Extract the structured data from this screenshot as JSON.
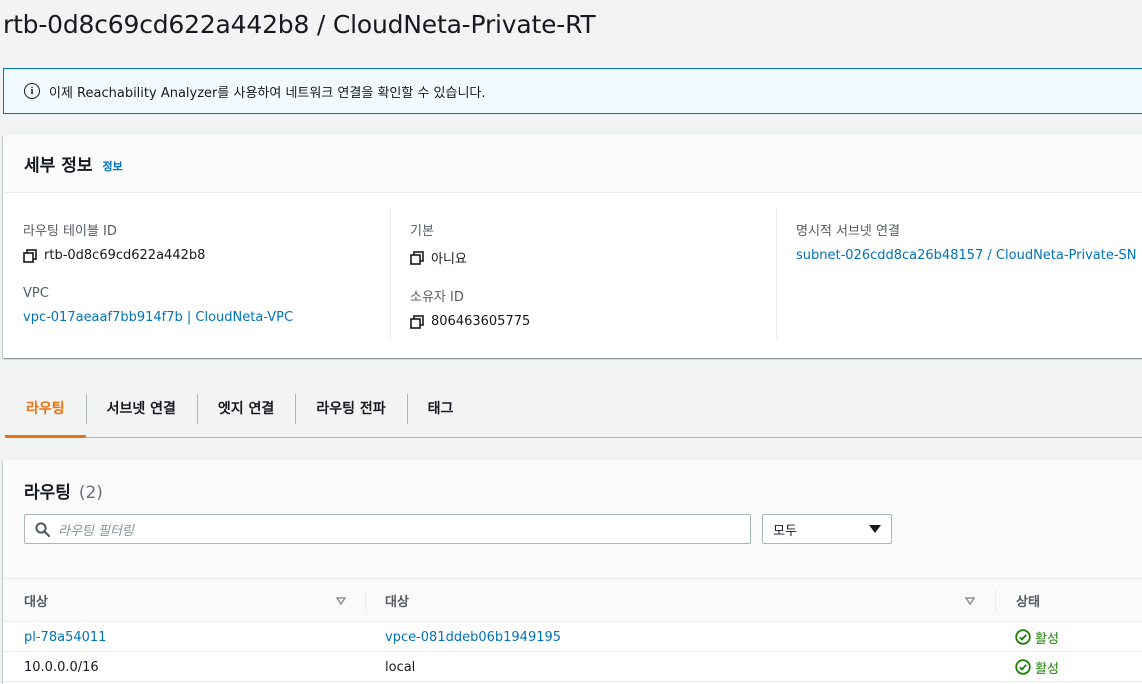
{
  "page": {
    "title": "rtb-0d8c69cd622a442b8 / CloudNeta-Private-RT"
  },
  "flash": {
    "text": "이제 Reachability Analyzer를 사용하여 네트워크 연결을 확인할 수 있습니다."
  },
  "details": {
    "title": "세부 정보",
    "info_link": "정보",
    "route_table_id_label": "라우팅 테이블 ID",
    "route_table_id_value": "rtb-0d8c69cd622a442b8",
    "vpc_label": "VPC",
    "vpc_value": "vpc-017aeaaf7bb914f7b | CloudNeta-VPC",
    "main_label": "기본",
    "main_value": "아니요",
    "owner_label": "소유자 ID",
    "owner_value": "806463605775",
    "subnet_assoc_label": "명시적 서브넷 연결",
    "subnet_assoc_value": "subnet-026cdd8ca26b48157 / CloudNeta-Private-SN"
  },
  "tabs": [
    {
      "label": "라우팅",
      "active": true
    },
    {
      "label": "서브넷 연결",
      "active": false
    },
    {
      "label": "엣지 연결",
      "active": false
    },
    {
      "label": "라우팅 전파",
      "active": false
    },
    {
      "label": "태그",
      "active": false
    }
  ],
  "routes": {
    "title": "라우팅",
    "count": "(2)",
    "search_placeholder": "라우팅 필터링",
    "filter_value": "모두",
    "columns": [
      "대상",
      "대상",
      "상태"
    ],
    "rows": [
      {
        "destination": "pl-78a54011",
        "target": "vpce-081ddeb06b1949195",
        "status": "활성",
        "dest_link": true,
        "target_link": true
      },
      {
        "destination": "10.0.0.0/16",
        "target": "local",
        "status": "활성",
        "dest_link": false,
        "target_link": false
      }
    ]
  },
  "colors": {
    "accent": "#ec7211",
    "link": "#0073bb",
    "success": "#1d8102"
  },
  "icons": {
    "flash": "info-icon",
    "copy": "copy-icon",
    "search": "search-icon",
    "status": "check-circle-icon",
    "sort": "sort-down-icon",
    "dropdown": "caret-down-icon"
  }
}
